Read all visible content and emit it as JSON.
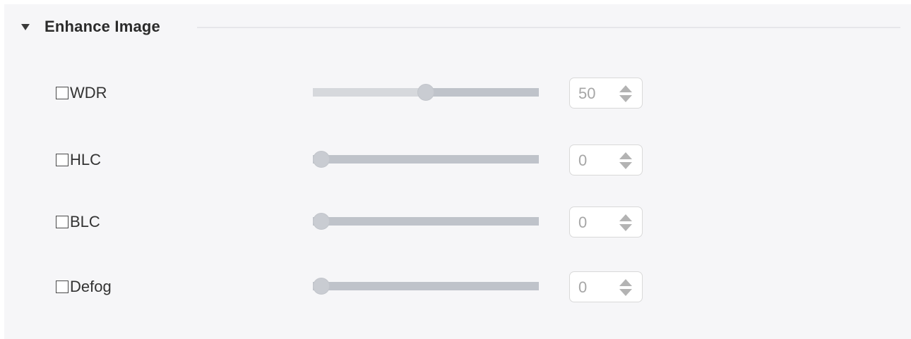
{
  "section": {
    "title": "Enhance Image",
    "collapse_icon": "triangle-down-icon"
  },
  "options": [
    {
      "label": "WDR",
      "checked": false,
      "value": "50",
      "slider_percent": 50
    },
    {
      "label": "HLC",
      "checked": false,
      "value": "0",
      "slider_percent": 0
    },
    {
      "label": "BLC",
      "checked": false,
      "value": "0",
      "slider_percent": 0
    },
    {
      "label": "Defog",
      "checked": false,
      "value": "0",
      "slider_percent": 0
    }
  ],
  "colors": {
    "panel_background": "#f6f6f8",
    "slider_track": "#bfc3ca",
    "slider_thumb": "#c9ccd2",
    "value_text_disabled": "#a6a6a6"
  }
}
